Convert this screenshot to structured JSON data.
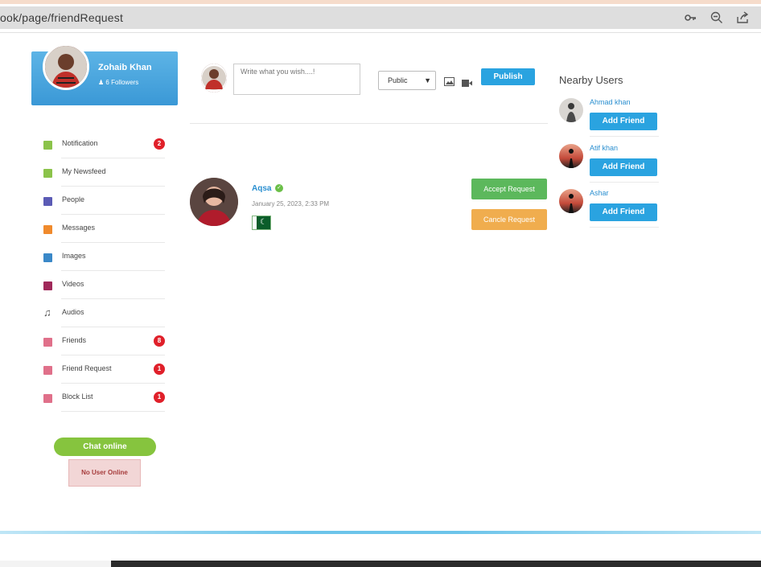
{
  "browser": {
    "url": "ook/page/friendRequest",
    "icons": [
      "key-icon",
      "zoom-out-icon",
      "share-icon"
    ]
  },
  "profile": {
    "name": "Zohaib Khan",
    "followers": "6 Followers"
  },
  "menu": [
    {
      "label": "Notification",
      "icon": "notification-icon",
      "color": "#8bc34a",
      "badge": "2"
    },
    {
      "label": "My Newsfeed",
      "icon": "newsfeed-icon",
      "color": "#8bc34a",
      "badge": null
    },
    {
      "label": "People",
      "icon": "people-icon",
      "color": "#5b5bb5",
      "badge": null
    },
    {
      "label": "Messages",
      "icon": "messages-icon",
      "color": "#f08a2c",
      "badge": null
    },
    {
      "label": "Images",
      "icon": "images-icon",
      "color": "#3a88c8",
      "badge": null
    },
    {
      "label": "Videos",
      "icon": "videos-icon",
      "color": "#a0295a",
      "badge": null
    },
    {
      "label": "Audios",
      "icon": "music-icon",
      "color": "#555555",
      "badge": null
    },
    {
      "label": "Friends",
      "icon": "friends-icon",
      "color": "#e0708a",
      "badge": "8"
    },
    {
      "label": "Friend Request",
      "icon": "friend-request-icon",
      "color": "#e0708a",
      "badge": "1"
    },
    {
      "label": "Block List",
      "icon": "block-list-icon",
      "color": "#e0708a",
      "badge": "1"
    }
  ],
  "chat": {
    "online_label": "Chat online",
    "status": "No User Online"
  },
  "composer": {
    "placeholder": "Write what you wish....!",
    "privacy": "Public",
    "publish": "Publish"
  },
  "request": {
    "name": "Aqsa",
    "date": "January 25, 2023, 2:33 PM",
    "accept": "Accept Request",
    "cancel": "Cancle Request"
  },
  "nearby": {
    "title": "Nearby Users",
    "add_label": "Add Friend",
    "users": [
      {
        "name": "Ahmad khan"
      },
      {
        "name": "Atif khan"
      },
      {
        "name": "Ashar"
      }
    ]
  },
  "colors": {
    "accent": "#2aa3e0",
    "badge": "#e0202a",
    "accept": "#5cb85c",
    "cancel": "#f0ad4e",
    "chat_online": "#86c43e"
  }
}
